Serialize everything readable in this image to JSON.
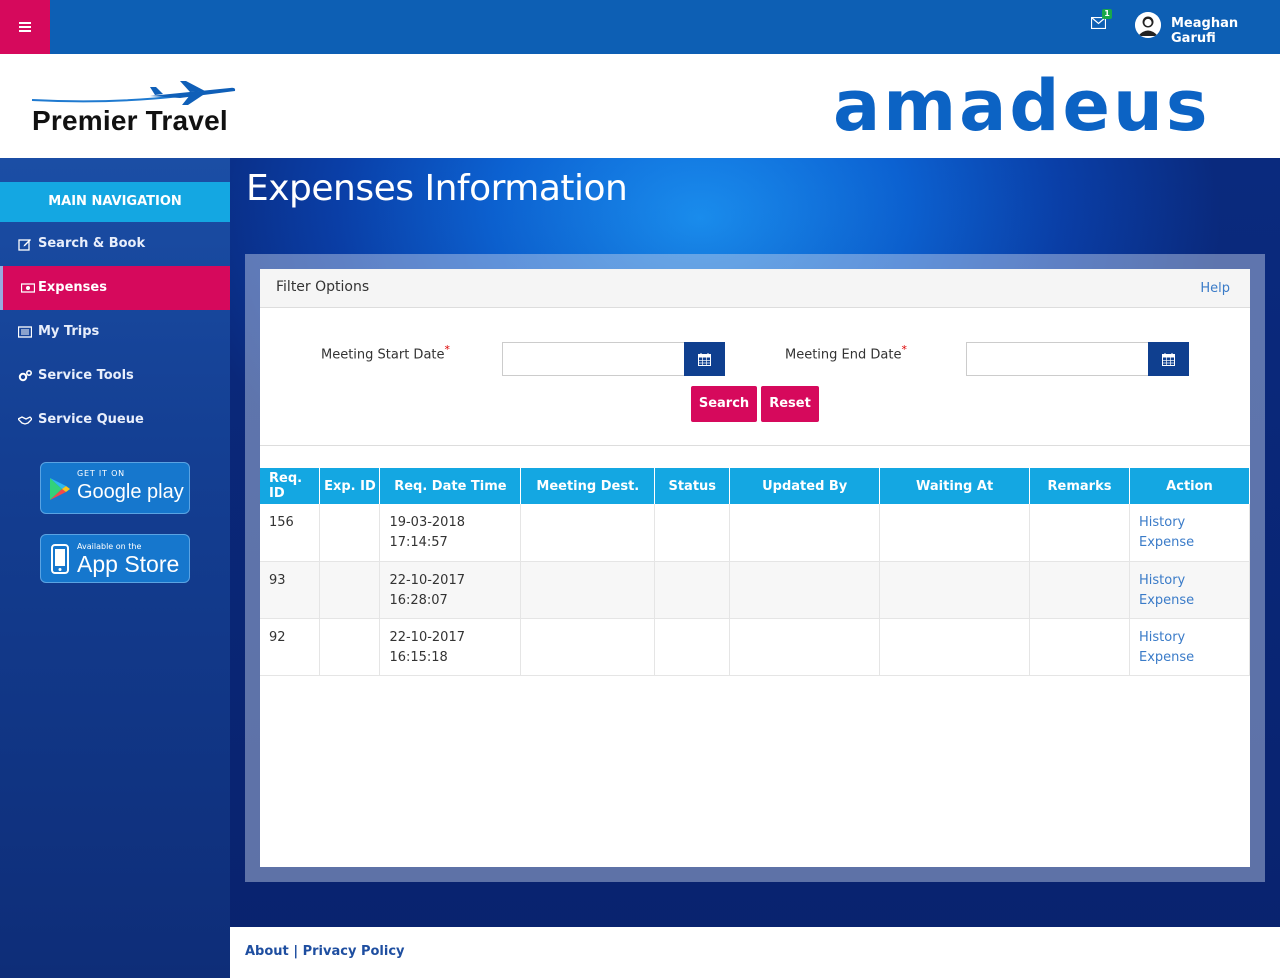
{
  "topbar": {
    "menu_icon": "hamburger-icon",
    "notifications": {
      "icon": "mail-icon",
      "count": "1"
    },
    "user": {
      "name": "Meaghan Garufi",
      "icon": "user-avatar-icon"
    }
  },
  "brand": {
    "left_logo": "Premier Travel",
    "right_logo": "amadeus"
  },
  "sidebar": {
    "header": "MAIN NAVIGATION",
    "items": [
      {
        "label": "Search & Book",
        "icon": "edit-icon",
        "active": false
      },
      {
        "label": "Expenses",
        "icon": "money-icon",
        "active": true
      },
      {
        "label": "My Trips",
        "icon": "list-icon",
        "active": false
      },
      {
        "label": "Service Tools",
        "icon": "cogs-icon",
        "active": false
      },
      {
        "label": "Service Queue",
        "icon": "handshake-icon",
        "active": false
      }
    ],
    "stores": {
      "google": {
        "small": "GET IT ON",
        "big": "Google play"
      },
      "apple": {
        "small": "Available on the",
        "big": "App Store"
      }
    }
  },
  "page": {
    "title": "Expenses Information"
  },
  "filter": {
    "title": "Filter Options",
    "help": "Help",
    "start_label": "Meeting Start Date",
    "end_label": "Meeting End Date",
    "required_mark": "*",
    "start_value": "",
    "end_value": "",
    "search": "Search",
    "reset": "Reset"
  },
  "table": {
    "headers": [
      "Req. ID",
      "Exp. ID",
      "Req. Date Time",
      "Meeting Dest.",
      "Status",
      "Updated By",
      "Waiting At",
      "Remarks",
      "Action"
    ],
    "rows": [
      {
        "req_id": "156",
        "exp_id": "",
        "date": "19-03-2018",
        "time": "17:14:57",
        "dest": "",
        "status": "",
        "updated_by": "",
        "waiting_at": "",
        "remarks": "",
        "action": "History Expense"
      },
      {
        "req_id": "93",
        "exp_id": "",
        "date": "22-10-2017",
        "time": "16:28:07",
        "dest": "",
        "status": "",
        "updated_by": "",
        "waiting_at": "",
        "remarks": "",
        "action": "History Expense"
      },
      {
        "req_id": "92",
        "exp_id": "",
        "date": "22-10-2017",
        "time": "16:15:18",
        "dest": "",
        "status": "",
        "updated_by": "",
        "waiting_at": "",
        "remarks": "",
        "action": "History Expense"
      }
    ]
  },
  "footer": {
    "about": "About",
    "separator": "|",
    "privacy": "Privacy Policy"
  },
  "colors": {
    "brand_blue": "#0d5fb4",
    "accent_pink": "#d6095c",
    "header_cyan": "#14a7e2",
    "amadeus_blue": "#0c63c4"
  }
}
